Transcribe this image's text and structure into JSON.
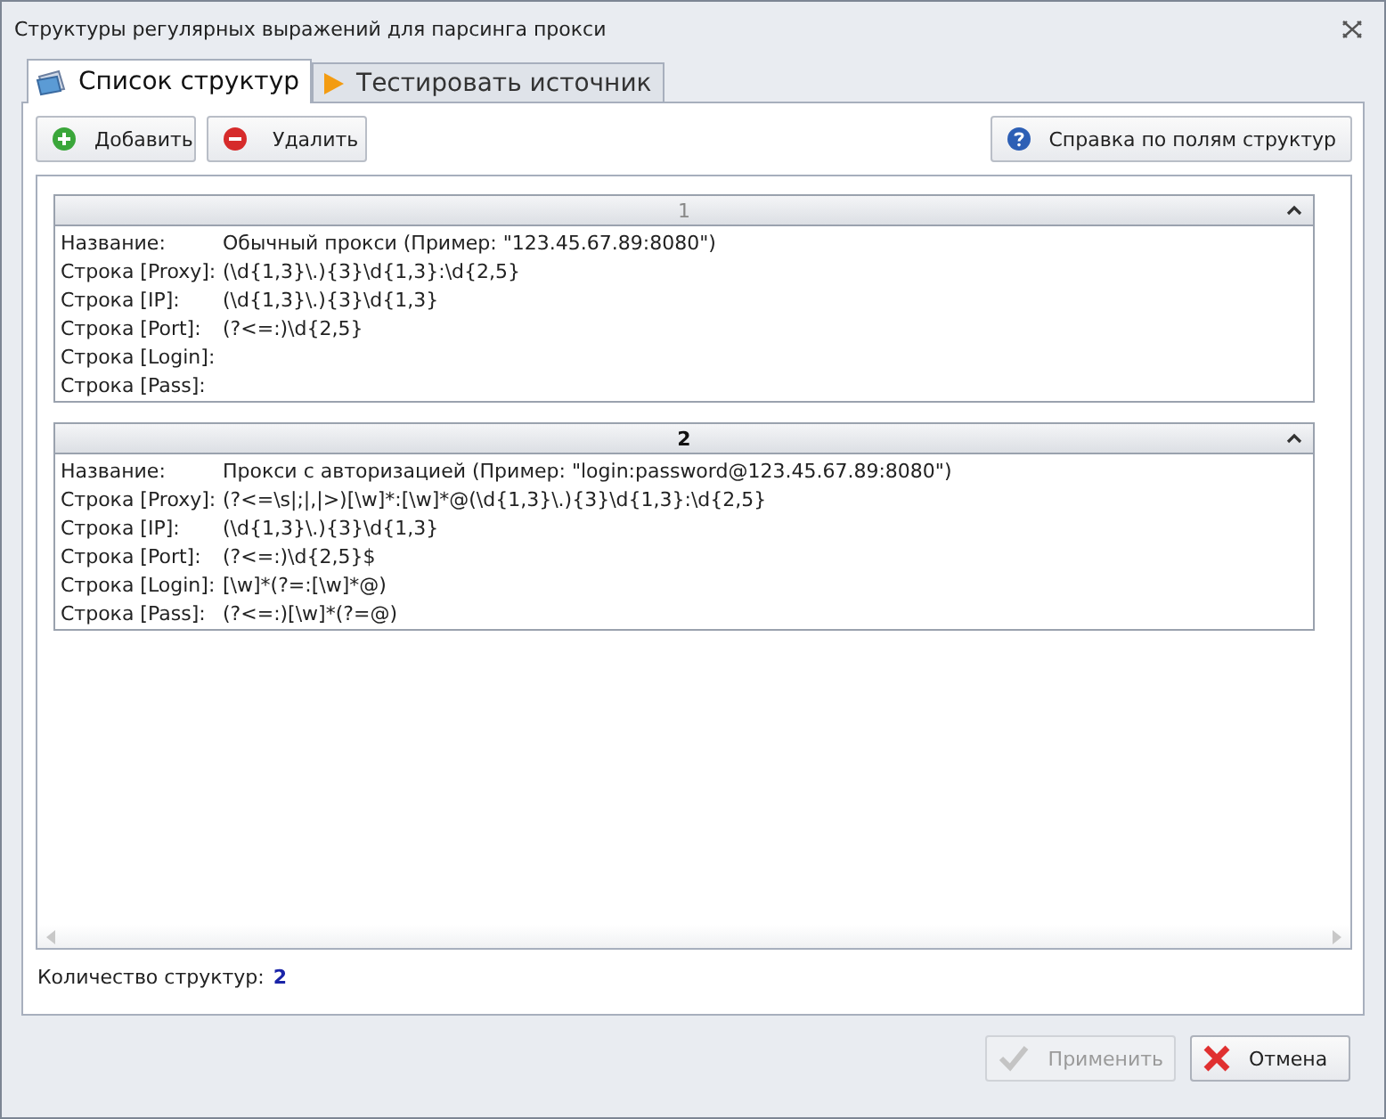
{
  "window": {
    "title": "Структуры регулярных выражений для парсинга прокси"
  },
  "tabs": [
    {
      "label": "Список структур",
      "selected": true,
      "kind": "list"
    },
    {
      "label": "Тестировать источник",
      "selected": false,
      "kind": "play"
    }
  ],
  "toolbar": [
    {
      "label": "Добавить",
      "kind": "add"
    },
    {
      "label": "Удалить",
      "kind": "remove"
    },
    {
      "label": "Справка по полям структур",
      "kind": "help"
    }
  ],
  "structures": [
    {
      "header": "1",
      "selected": false,
      "expanded": true,
      "fields": [
        {
          "label": "Название:",
          "value": "Обычный прокси (Пример: \"123.45.67.89:8080\")"
        },
        {
          "label": "Строка [Proxy]:",
          "value": "(\\d{1,3}\\.){3}\\d{1,3}:\\d{2,5}"
        },
        {
          "label": "Строка [IP]:",
          "value": "(\\d{1,3}\\.){3}\\d{1,3}"
        },
        {
          "label": "Строка [Port]:",
          "value": "(?<=:)\\d{2,5}"
        },
        {
          "label": "Строка [Login]:"
        },
        {
          "label": "Строка [Pass]:"
        }
      ]
    },
    {
      "header": "2",
      "selected": true,
      "expanded": true,
      "fields": [
        {
          "label": "Название:",
          "value": "Прокси с авторизацией (Пример: \"login:password@123.45.67.89:8080\")"
        },
        {
          "label": "Строка [Proxy]:",
          "value": "(?<=\\s|;|,|>)[\\w]*:[\\w]*@(\\d{1,3}\\.){3}\\d{1,3}:\\d{2,5}"
        },
        {
          "label": "Строка [IP]:",
          "value": "(\\d{1,3}\\.){3}\\d{1,3}"
        },
        {
          "label": "Строка [Port]:",
          "value": "(?<=:)\\d{2,5}$"
        },
        {
          "label": "Строка [Login]:",
          "value": "[\\w]*(?=:[\\w]*@)"
        },
        {
          "label": "Строка [Pass]:",
          "value": "(?<=:)[\\w]*(?=@)"
        }
      ]
    }
  ],
  "count": {
    "label": "Количество структур:",
    "value": "2"
  },
  "buttons": [
    {
      "label": "Применить",
      "kind": "apply",
      "disabled": true
    },
    {
      "label": "Отмена",
      "kind": "cancel",
      "disabled": false
    }
  ]
}
